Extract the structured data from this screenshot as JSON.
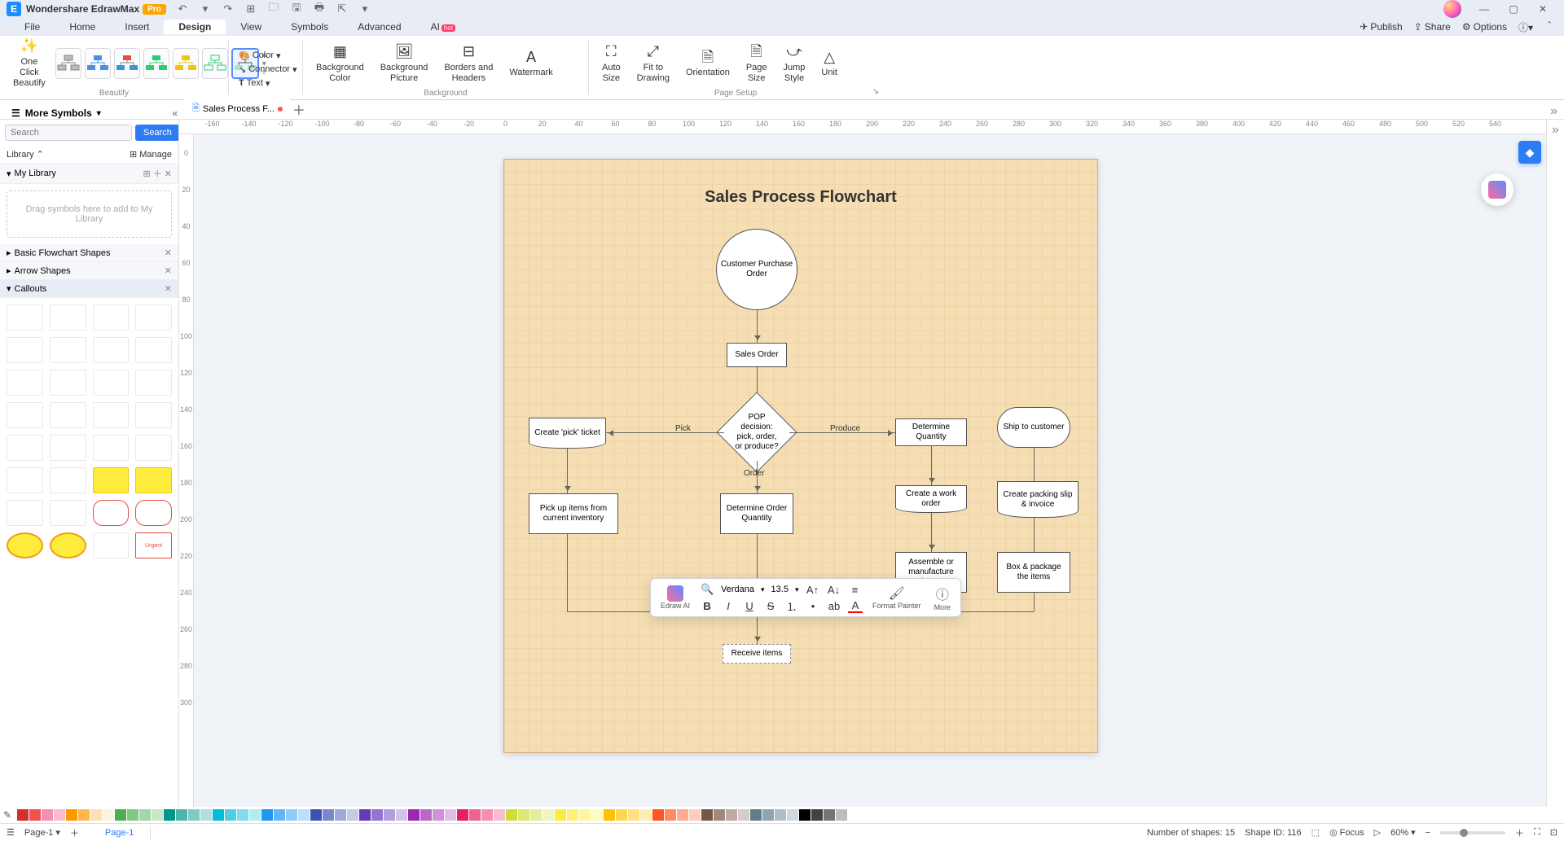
{
  "title": {
    "app": "Wondershare EdrawMax",
    "badge": "Pro"
  },
  "menu": {
    "items": [
      "File",
      "Home",
      "Insert",
      "Design",
      "View",
      "Symbols",
      "Advanced",
      "AI"
    ],
    "active": "Design",
    "right": [
      "Publish",
      "Share",
      "Options"
    ]
  },
  "ribbon": {
    "one_click": "One Click\nBeautify",
    "beautify_label": "Beautify",
    "color": "Color",
    "connector": "Connector",
    "text": "Text",
    "bg_color": "Background\nColor",
    "bg_pic": "Background\nPicture",
    "borders": "Borders and\nHeaders",
    "watermark": "Watermark",
    "auto_size": "Auto\nSize",
    "fit": "Fit to\nDrawing",
    "orientation": "Orientation",
    "page_size": "Page\nSize",
    "jump_style": "Jump\nStyle",
    "unit": "Unit",
    "background_label": "Background",
    "page_setup_label": "Page Setup"
  },
  "symbols": {
    "header": "More Symbols",
    "search_placeholder": "Search",
    "search_btn": "Search",
    "library": "Library",
    "manage": "Manage",
    "my_library": "My Library",
    "drop_hint": "Drag symbols here to add to My Library",
    "basic": "Basic Flowchart Shapes",
    "arrow": "Arrow Shapes",
    "callouts": "Callouts"
  },
  "doctab": {
    "name": "Sales Process F...",
    "dirty": true
  },
  "ruler_h": [
    "-160",
    "-140",
    "-120",
    "-100",
    "-80",
    "-60",
    "-40",
    "-20",
    "0",
    "20",
    "40",
    "60",
    "80",
    "100",
    "120",
    "140",
    "160",
    "180",
    "200",
    "220",
    "240",
    "260",
    "280",
    "300",
    "320",
    "340",
    "360",
    "380",
    "400",
    "420",
    "440",
    "460",
    "480",
    "500",
    "520",
    "540"
  ],
  "ruler_v": [
    "0",
    "20",
    "40",
    "60",
    "80",
    "100",
    "120",
    "140",
    "160",
    "180",
    "200",
    "220",
    "240",
    "260",
    "280",
    "300"
  ],
  "flowchart": {
    "title": "Sales Process Flowchart",
    "s1": "Customer Purchase Order",
    "s2": "Sales Order",
    "s3": "POP decision: pick, order, or produce?",
    "s4": "Create 'pick' ticket",
    "s5": "Determine Quantity",
    "s6": "Ship to customer",
    "s7": "Pick up items from current inventory",
    "s8": "Determine Order Quantity",
    "s9": "Create a work order",
    "s10": "Create packing slip & invoice",
    "s11": "Assemble or manufacture items",
    "s12": "Box & package the items",
    "s13": "Receive items",
    "l_pick": "Pick",
    "l_order": "Order",
    "l_produce": "Produce"
  },
  "mini": {
    "ai": "Edraw AI",
    "font": "Verdana",
    "size": "13.5",
    "format_painter": "Format Painter",
    "more": "More"
  },
  "colors": [
    "#d32f2f",
    "#ef5350",
    "#f48fb1",
    "#f8bbd0",
    "#ff9800",
    "#ffb74d",
    "#ffe0b2",
    "#fff3e0",
    "#4caf50",
    "#81c784",
    "#a5d6a7",
    "#c8e6c9",
    "#009688",
    "#4db6ac",
    "#80cbc4",
    "#b2dfdb",
    "#00bcd4",
    "#4dd0e1",
    "#80deea",
    "#b2ebf2",
    "#2196f3",
    "#64b5f6",
    "#90caf9",
    "#bbdefb",
    "#3f51b5",
    "#7986cb",
    "#9fa8da",
    "#c5cae9",
    "#673ab7",
    "#9575cd",
    "#b39ddb",
    "#d1c4e9",
    "#9c27b0",
    "#ba68c8",
    "#ce93d8",
    "#e1bee7",
    "#e91e63",
    "#f06292",
    "#f48fb1",
    "#f8bbd0",
    "#cddc39",
    "#dce775",
    "#e6ee9c",
    "#f0f4c3",
    "#ffeb3b",
    "#fff176",
    "#fff59d",
    "#fff9c4",
    "#ffc107",
    "#ffd54f",
    "#ffe082",
    "#ffecb3",
    "#ff5722",
    "#ff8a65",
    "#ffab91",
    "#ffccbc",
    "#795548",
    "#a1887f",
    "#bcaaa4",
    "#d7ccc8",
    "#607d8b",
    "#90a4ae",
    "#b0bec5",
    "#cfd8dc",
    "#000000",
    "#424242",
    "#757575",
    "#bdbdbd",
    "#ffffff"
  ],
  "status": {
    "page_sel": "Page-1",
    "page_tab": "Page-1",
    "shapes": "Number of shapes: 15",
    "shape_id": "Shape ID: 116",
    "focus": "Focus",
    "zoom": "60%"
  }
}
